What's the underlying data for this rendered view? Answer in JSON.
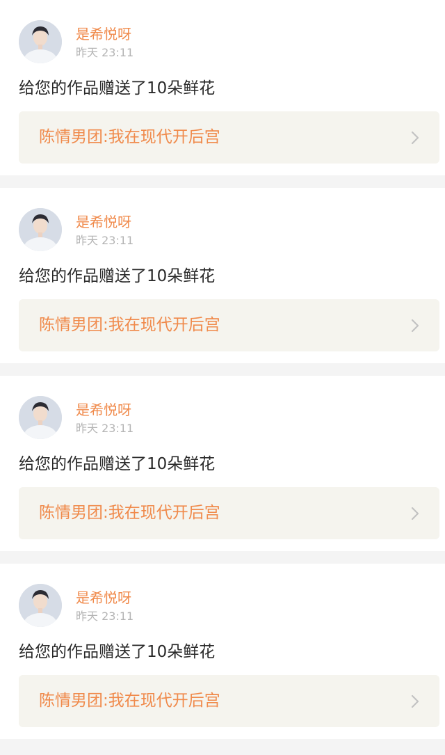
{
  "notifications": [
    {
      "user": "是希悦呀",
      "avatar_icon": "user-avatar-photo",
      "time": "昨天 23:11",
      "message": "给您的作品赠送了10朵鲜花",
      "work_title": "陈情男团:我在现代开后宫"
    },
    {
      "user": "是希悦呀",
      "avatar_icon": "user-avatar-photo",
      "time": "昨天 23:11",
      "message": "给您的作品赠送了10朵鲜花",
      "work_title": "陈情男团:我在现代开后宫"
    },
    {
      "user": "是希悦呀",
      "avatar_icon": "user-avatar-photo",
      "time": "昨天 23:11",
      "message": "给您的作品赠送了10朵鲜花",
      "work_title": "陈情男团:我在现代开后宫"
    },
    {
      "user": "是希悦呀",
      "avatar_icon": "user-avatar-photo",
      "time": "昨天 23:11",
      "message": "给您的作品赠送了10朵鲜花",
      "work_title": "陈情男团:我在现代开后宫"
    }
  ],
  "colors": {
    "accent": "#f08a4b",
    "timestamp": "#b4b4b4",
    "text": "#2a2a2a",
    "link_bg": "#f5f4ee",
    "page_bg": "#f4f4f4"
  },
  "icons": {
    "link_chevron": "chevron-right-icon"
  }
}
